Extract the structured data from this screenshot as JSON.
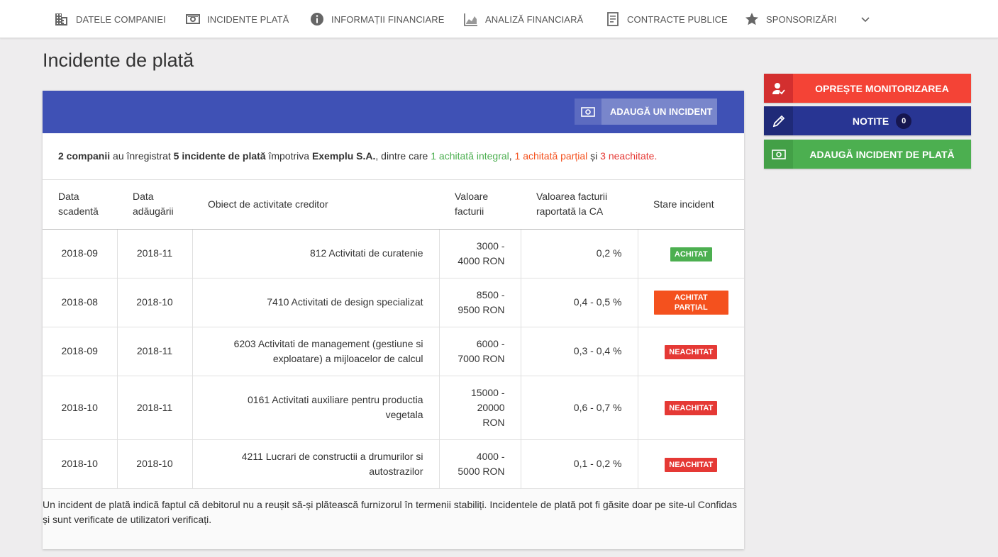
{
  "nav": {
    "items": [
      {
        "label": "DATELE COMPANIEI",
        "icon": "building-icon"
      },
      {
        "label": "INCIDENTE PLATĂ",
        "icon": "cash-icon"
      },
      {
        "label": "INFORMAȚII FINANCIARE",
        "icon": "info-icon"
      },
      {
        "label": "ANALIZĂ FINANCIARĂ",
        "icon": "area-chart-icon"
      },
      {
        "label": "CONTRACTE PUBLICE",
        "icon": "document-icon"
      },
      {
        "label": "SPONSORIZĂRI",
        "icon": "star-icon"
      }
    ],
    "more_icon": "chevron-down-icon"
  },
  "page": {
    "title": "Incidente de plată"
  },
  "card": {
    "add_button_label": "ADAUGĂ UN INCIDENT",
    "summary": {
      "companies": "2 companii",
      "registered": " au înregistrat ",
      "incidents": "5 incidente de plată",
      "against": " împotriva ",
      "company": "Exemplu S.A.",
      "among": ", dintre care ",
      "paid": "1 achitată integral",
      "sep1": ", ",
      "partial": "1 achitată parțial",
      "and": " și ",
      "unpaid": "3 neachitate",
      "end": "."
    },
    "table": {
      "headers": {
        "due_date": "Data scadentă",
        "added_date": "Data adăugării",
        "activity": "Obiect de activitate creditor",
        "invoice_value": "Valoare facturii",
        "ratio": "Valoarea facturii raportată la CA",
        "status": "Stare incident"
      },
      "rows": [
        {
          "due": "2018-09",
          "added": "2018-11",
          "activity": "812 Activitati de curatenie",
          "value": "3000 - 4000 RON",
          "ratio": "0,2 %",
          "status": "ACHITAT",
          "status_color": "#4caf50"
        },
        {
          "due": "2018-08",
          "added": "2018-10",
          "activity": "7410 Activitati de design specializat",
          "value": "8500 - 9500 RON",
          "ratio": "0,4 - 0,5 %",
          "status": "ACHITAT PARȚIAL",
          "status_color": "#f4511e"
        },
        {
          "due": "2018-09",
          "added": "2018-11",
          "activity": "6203 Activitati de management (gestiune si exploatare) a mijloacelor de calcul",
          "value": "6000 - 7000 RON",
          "ratio": "0,3 - 0,4 %",
          "status": "NEACHITAT",
          "status_color": "#e53935"
        },
        {
          "due": "2018-10",
          "added": "2018-11",
          "activity": "0161 Activitati auxiliare pentru productia vegetala",
          "value": "15000 - 20000 RON",
          "ratio": "0,6 - 0,7 %",
          "status": "NEACHITAT",
          "status_color": "#e53935"
        },
        {
          "due": "2018-10",
          "added": "2018-10",
          "activity": "4211 Lucrari de constructii a drumurilor si autostrazilor",
          "value": "4000 - 5000 RON",
          "ratio": "0,1 - 0,2 %",
          "status": "NEACHITAT",
          "status_color": "#e53935"
        }
      ]
    },
    "footnote": "Un incident de plată indică faptul că debitorul nu a reușit să-și plătească furnizorul în termenii stabiliți. Incidentele de plată pot fi găsite doar pe site-ul Confidas și sunt verificate de utilizatori verificați."
  },
  "side": {
    "stop_monitoring": "OPREȘTE MONITORIZAREA",
    "notes": "NOTITE",
    "notes_count": "0",
    "add_payment_incident": "ADAUGĂ INCIDENT DE PLATĂ"
  },
  "colors": {
    "primary": "#3f51b5",
    "red": "#f44336",
    "indigo_dark": "#283593",
    "green": "#4caf50",
    "orange": "#f4511e"
  }
}
